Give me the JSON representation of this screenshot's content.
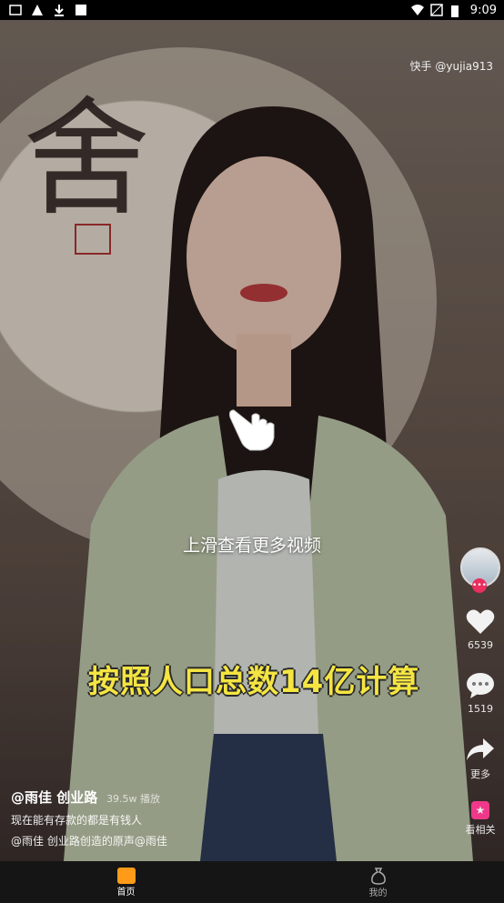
{
  "status_bar": {
    "time": "9:09"
  },
  "video": {
    "watermark": "快手 @yujia913",
    "swipe_hint": "上滑查看更多视频",
    "subtitle": "按照人口总数14亿计算"
  },
  "right_rail": {
    "likes": "6539",
    "comments": "1519",
    "share_label": "更多",
    "related_label": "看相关"
  },
  "info": {
    "author": "@雨佳 创业路",
    "plays": "39.5w 播放",
    "caption": "现在能有存款的都是有钱人",
    "music": "@雨佳 创业路创造的原声@雨佳"
  },
  "tabbar": {
    "home": "首页",
    "mine": "我的"
  },
  "colors": {
    "accent": "#ff9b18",
    "subtitle": "#f4e542",
    "badge": "#e82f5e"
  }
}
